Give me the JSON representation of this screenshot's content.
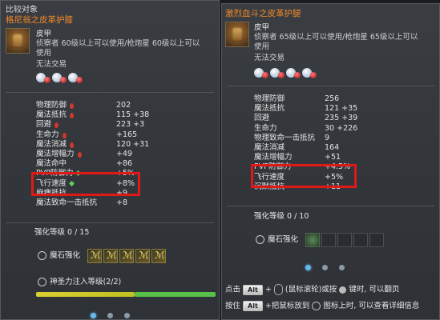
{
  "left": {
    "header": "比较对象",
    "item_name": "格尼翁之皮革护膝",
    "item_type": "皮甲",
    "req_line1": "侦察者 60级以上可以使用/枪炮星 60级以上可以",
    "req_line2": "使用",
    "trade": "无法交易",
    "stats": [
      {
        "label": "物理防御",
        "value": "202",
        "marker": "red"
      },
      {
        "label": "魔法抵抗",
        "value": "115 +38",
        "marker": "red"
      },
      {
        "label": "回避",
        "value": "223 +3",
        "marker": "red"
      },
      {
        "label": "生命力",
        "value": "+165",
        "marker": "red"
      },
      {
        "label": "魔法消减",
        "value": "120 +31",
        "marker": "red"
      },
      {
        "label": "魔法增幅力",
        "value": "+49",
        "marker": "red"
      },
      {
        "label": "魔法命中",
        "value": "+86",
        "marker": ""
      },
      {
        "label": "PVP防御力",
        "value": "+5%",
        "marker": "green"
      },
      {
        "label": "飞行速度",
        "value": "+8%",
        "marker": "green"
      },
      {
        "label": "麻痹抵抗",
        "value": "+9",
        "marker": ""
      },
      {
        "label": "魔法致命一击抵抗",
        "value": "+8",
        "marker": ""
      }
    ],
    "enhance": "强化等级  0 / 15",
    "manastone": "魔石强化",
    "divine": "神圣力注入等级(2/2)",
    "bar_fill": 0.55,
    "colors": {
      "accent": "#f28a28",
      "highlight": "#e01818"
    }
  },
  "right": {
    "item_name": "激烈血斗之皮革护腿",
    "item_type": "皮甲",
    "req_line1": "侦察者 65级以上可以使用/枪炮星 65级以上可以",
    "req_line2": "使用",
    "trade": "无法交易",
    "stats": [
      {
        "label": "物理防御",
        "value": "256"
      },
      {
        "label": "魔法抵抗",
        "value": "121 +35"
      },
      {
        "label": "回避",
        "value": "235 +39"
      },
      {
        "label": "生命力",
        "value": "30 +226"
      },
      {
        "label": "物理致命一击抵抗",
        "value": "9"
      },
      {
        "label": "魔法消减",
        "value": "164"
      },
      {
        "label": "魔法增幅力",
        "value": "+51"
      },
      {
        "label": "PVP防御力",
        "value": "+4.5%"
      },
      {
        "label": "飞行速度",
        "value": "+5%"
      },
      {
        "label": "沉默抵抗",
        "value": "+11"
      }
    ],
    "enhance": "强化等级  0 / 10",
    "manastone": "魔石强化",
    "help1_pre": "点击",
    "help1_key": "Alt",
    "help1_mid": "+",
    "help1_post": "(鼠标滚轮)或按",
    "help1_end": "键时, 可以翻页",
    "help2_pre": "按住",
    "help2_key": "Alt",
    "help2_post": "+把鼠标放到",
    "help2_end": "图标上时, 可以查看详细信息"
  }
}
